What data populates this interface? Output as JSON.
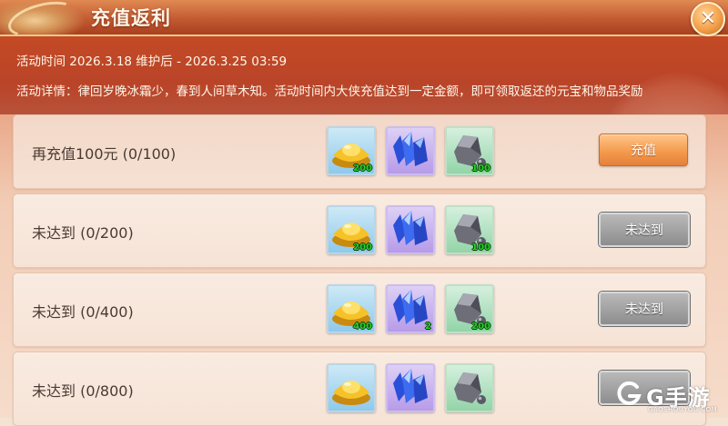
{
  "header": {
    "title": "充值返利",
    "close_icon": "close-icon"
  },
  "info": {
    "time": "活动时间 2026.3.18 维护后 - 2026.3.25 03:59",
    "detail": "活动详情：律回岁晚冰霜少，春到人间草木知。活动时间内大侠充值达到一定金额，即可领取返还的元宝和物品奖励"
  },
  "rows": [
    {
      "label": "再充值100元 (0/100)",
      "rewards": [
        {
          "icon": "gold-ingot-icon",
          "count": "200"
        },
        {
          "icon": "blue-crystal-icon",
          "count": ""
        },
        {
          "icon": "ore-icon",
          "count": "100"
        }
      ],
      "button": "充值",
      "state": "active"
    },
    {
      "label": "未达到 (0/200)",
      "rewards": [
        {
          "icon": "gold-ingot-icon",
          "count": "200"
        },
        {
          "icon": "blue-crystal-icon",
          "count": ""
        },
        {
          "icon": "ore-icon",
          "count": "100"
        }
      ],
      "button": "未达到",
      "state": "disabled"
    },
    {
      "label": "未达到 (0/400)",
      "rewards": [
        {
          "icon": "gold-ingot-icon",
          "count": "400"
        },
        {
          "icon": "blue-crystal-icon",
          "count": "2"
        },
        {
          "icon": "ore-icon",
          "count": "200"
        }
      ],
      "button": "未达到",
      "state": "disabled"
    },
    {
      "label": "未达到 (0/800)",
      "rewards": [
        {
          "icon": "gold-ingot-icon",
          "count": ""
        },
        {
          "icon": "blue-crystal-icon",
          "count": ""
        },
        {
          "icon": "ore-icon",
          "count": ""
        }
      ],
      "button": "",
      "state": "disabled"
    }
  ],
  "watermark": {
    "text": "G手游",
    "sub": "GAOSHOUYOU.COM"
  },
  "colors": {
    "header": "#c35a32",
    "info_bg": "#c44a25",
    "recharge_button": "#f49b4d",
    "disabled_button": "#9a9a9a",
    "count_text": "#2bd12b"
  }
}
